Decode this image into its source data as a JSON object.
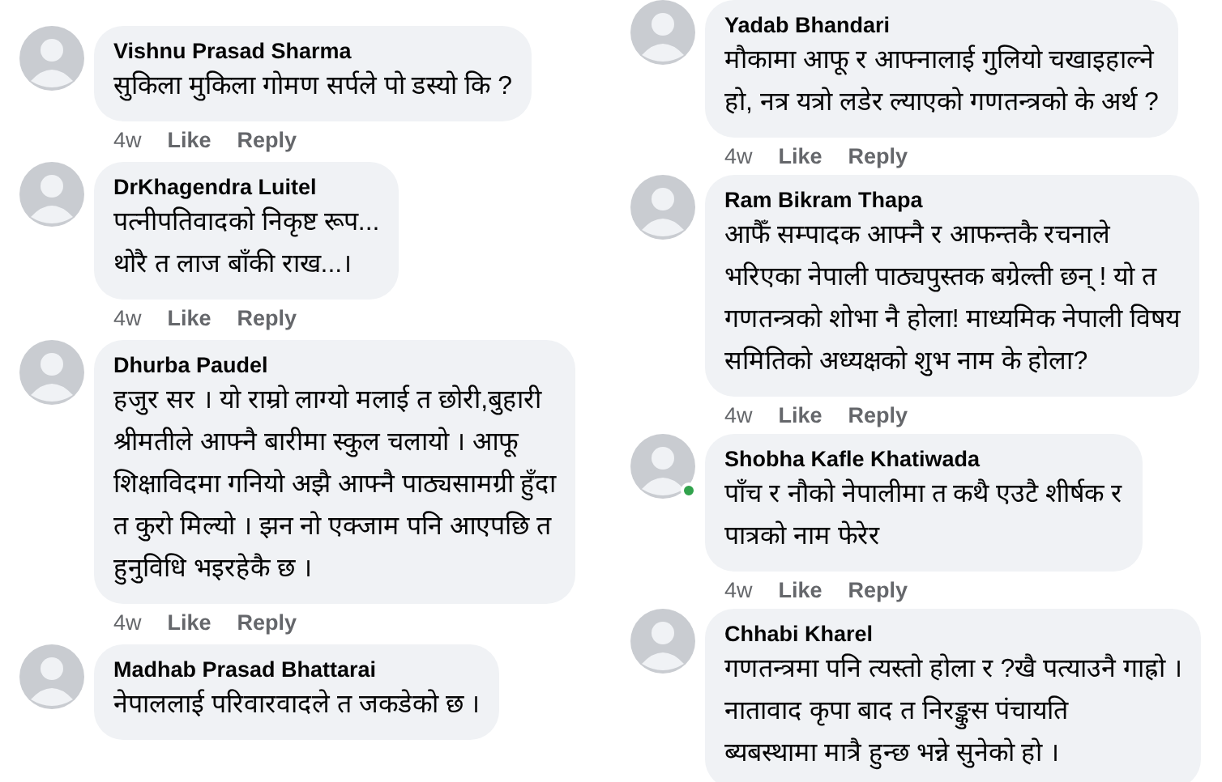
{
  "columns": [
    {
      "comments": [
        {
          "author": "Vishnu Prasad Sharma",
          "online": false,
          "text": "सुकिला मुकिला गोमण सर्पले पो डस्यो कि ?",
          "time": "4w",
          "like": "Like",
          "reply": "Reply"
        },
        {
          "author": "DrKhagendra Luitel",
          "online": false,
          "text": "पत्नीपतिवादको निकृष्ट रूप...\nथोरै त लाज बाँकी राख...।",
          "time": "4w",
          "like": "Like",
          "reply": "Reply"
        },
        {
          "author": "Dhurba Paudel",
          "online": false,
          "text": "हजुर सर । यो राम्रो लाग्यो मलाई त छोरी,बुहारी\nश्रीमतीले  आफ्नै बारीमा स्कुल चलायो । आफू\nशिक्षाविदमा गनियो अझै आफ्नै पाठ्यसामग्री हुँदा\nत कुरो मिल्यो । झन नो एक्जाम पनि आएपछि त\nहुनुविधि भइरहेकै छ ।",
          "time": "4w",
          "like": "Like",
          "reply": "Reply"
        },
        {
          "author": "Madhab Prasad Bhattarai",
          "online": false,
          "text": "नेपाललाई परिवारवादले त जकडेको छ ।"
        }
      ]
    },
    {
      "comments": [
        {
          "author": "Yadab Bhandari",
          "online": false,
          "text": "मौकामा आफू र आफ्नालाई गुलियो चखाइहाल्ने\nहो, नत्र यत्रो लडेर ल्याएको गणतन्त्रको के अर्थ ?",
          "time": "4w",
          "like": "Like",
          "reply": "Reply"
        },
        {
          "author": "Ram Bikram Thapa",
          "online": false,
          "text": "आफैँ सम्पादक आफ्नै र आफन्तकै रचनाले\nभरिएका नेपाली पाठ्यपुस्तक बग्रेल्ती छन् ! यो त\nगणतन्त्रको शोभा नै होला! माध्यमिक नेपाली विषय\nसमितिको अध्यक्षको शुभ नाम के होला?",
          "time": "4w",
          "like": "Like",
          "reply": "Reply"
        },
        {
          "author": "Shobha Kafle Khatiwada",
          "online": true,
          "text": "पाँच र नौको नेपालीमा त कथै एउटै शीर्षक र\nपात्रको नाम फेरेर",
          "time": "4w",
          "like": "Like",
          "reply": "Reply"
        },
        {
          "author": "Chhabi Kharel",
          "online": false,
          "text": "गणतन्त्रमा पनि त्यस्तो होला र ?खै पत्याउनै गाह्रो ।\nनातावाद कृपा बाद त निरङ्कुस पंचायति\nब्यबस्थामा मात्रै हुन्छ भन्ने सुनेको हो ।"
        }
      ]
    }
  ]
}
